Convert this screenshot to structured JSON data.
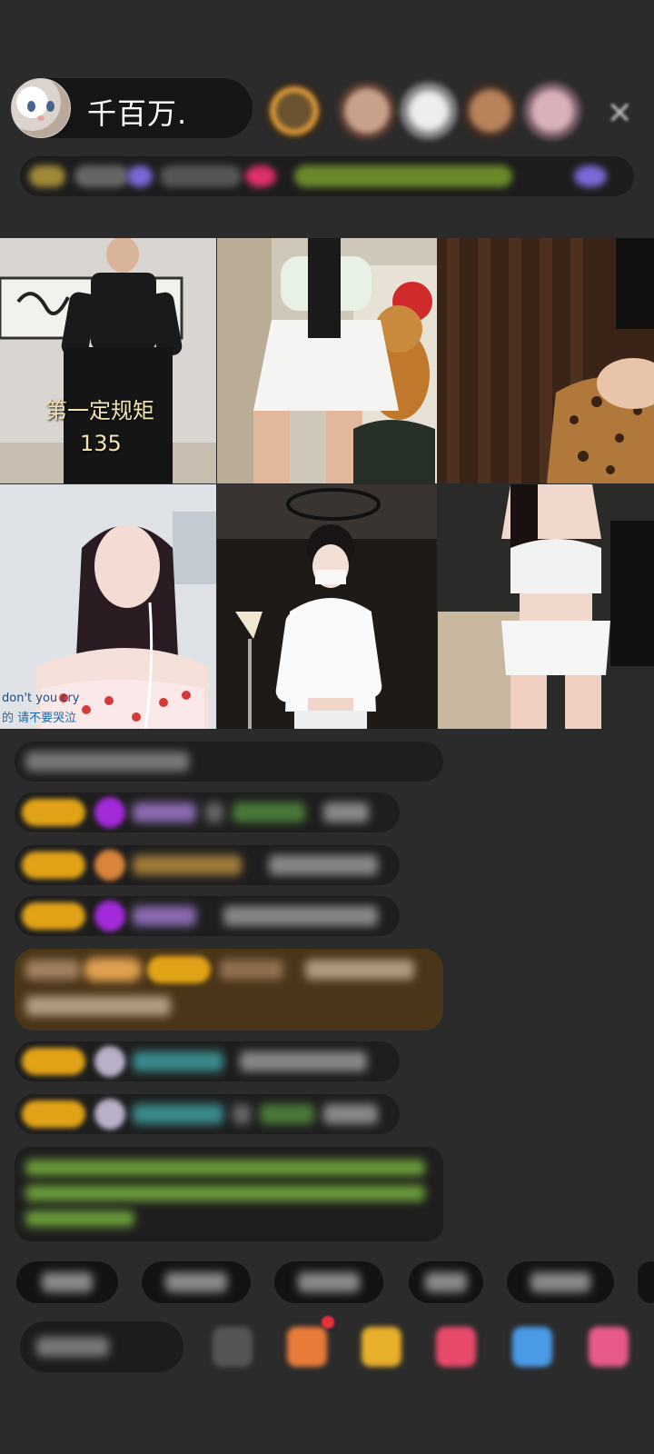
{
  "host": {
    "name": "千百万."
  },
  "video": {
    "tile1_caption": "第一定规矩",
    "tile1_count": "135",
    "tile4_song_en": "don't you cry",
    "tile4_song_cn": "的 请不要哭泣"
  },
  "colors": {
    "background": "#2b2b2b",
    "badge_gold": "#e0a217",
    "chat_bubble": "#1e1e1e",
    "highlight_bubble": "#4a3518",
    "notice_text": "#9ccf4a"
  },
  "icons": [
    "close-icon",
    "diamond-icon",
    "gift-icon",
    "heart-icon",
    "emoji-icon"
  ]
}
